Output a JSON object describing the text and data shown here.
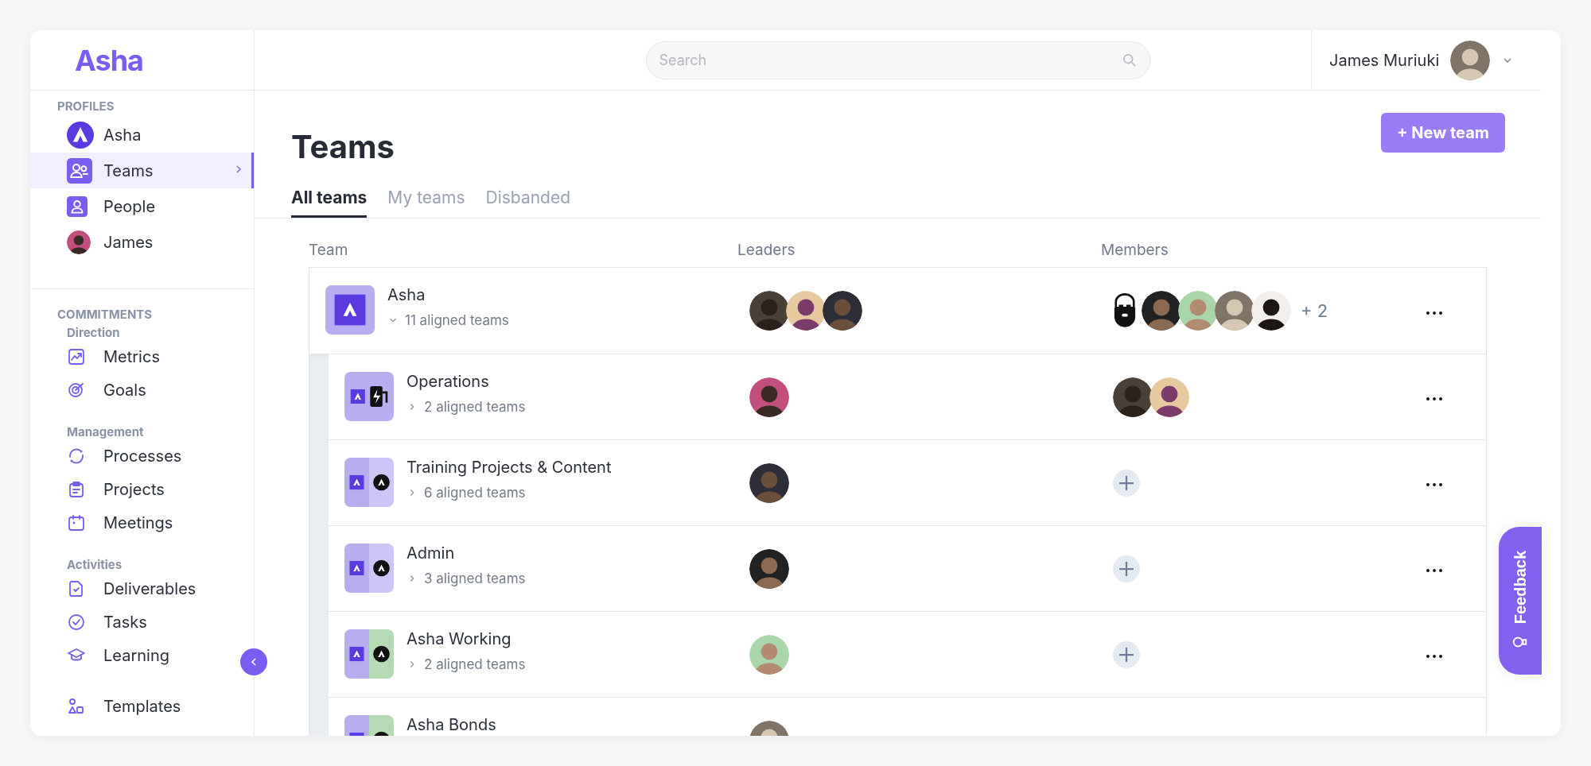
{
  "logo": "Asha",
  "sidebar": {
    "sections": [
      {
        "heading": "PROFILES",
        "groups": [
          {
            "items": [
              {
                "label": "Asha",
                "selected": false
              },
              {
                "label": "Teams",
                "selected": true
              },
              {
                "label": "People",
                "selected": false
              },
              {
                "label": "James",
                "selected": false
              }
            ]
          }
        ]
      },
      {
        "heading": "COMMITMENTS",
        "groups": [
          {
            "title": "Direction",
            "items": [
              {
                "label": "Metrics",
                "selected": false
              },
              {
                "label": "Goals",
                "selected": false
              }
            ]
          },
          {
            "title": "Management",
            "items": [
              {
                "label": "Processes",
                "selected": false
              },
              {
                "label": "Projects",
                "selected": false
              },
              {
                "label": "Meetings",
                "selected": false
              }
            ]
          },
          {
            "title": "Activities",
            "items": [
              {
                "label": "Deliverables",
                "selected": false
              },
              {
                "label": "Tasks",
                "selected": false
              },
              {
                "label": "Learning",
                "selected": false
              }
            ]
          },
          {
            "items": [
              {
                "label": "Templates",
                "selected": false
              }
            ]
          }
        ]
      }
    ]
  },
  "search": {
    "placeholder": "Search"
  },
  "user": {
    "name": "James Muriuki"
  },
  "page_title": "Teams",
  "new_button": "+ New team",
  "tabs": [
    {
      "label": "All teams",
      "selected": true
    },
    {
      "label": "My teams",
      "selected": false
    },
    {
      "label": "Disbanded",
      "selected": false
    }
  ],
  "table": {
    "columns": [
      "Team",
      "Leaders",
      "Members"
    ],
    "rows": [
      {
        "name": "Asha",
        "aligned": "11 aligned teams",
        "expanded": true,
        "icon": {
          "kind": "single"
        },
        "leaders": [
          {
            "kind": "photo"
          },
          {
            "kind": "photo"
          },
          {
            "kind": "photo"
          }
        ],
        "members": [
          {
            "kind": "illustration"
          },
          {
            "kind": "photo"
          },
          {
            "kind": "photo"
          },
          {
            "kind": "photo"
          },
          {
            "kind": "photo"
          }
        ],
        "members_more": "+ 2",
        "children": [
          {
            "name": "Operations",
            "aligned": "2 aligned teams",
            "expanded": false,
            "icon": {
              "kind": "bolt"
            },
            "leaders": [
              {
                "kind": "photo"
              }
            ],
            "members": [
              {
                "kind": "photo"
              },
              {
                "kind": "photo"
              }
            ]
          },
          {
            "name": "Training Projects & Content",
            "aligned": "6 aligned teams",
            "expanded": false,
            "icon": {
              "kind": "pair",
              "color": "#cbc6f6"
            },
            "leaders": [
              {
                "kind": "photo"
              }
            ]
          },
          {
            "name": "Admin",
            "aligned": "3 aligned teams",
            "expanded": false,
            "icon": {
              "kind": "pair",
              "color": "#cbc6f6"
            },
            "leaders": [
              {
                "kind": "photo"
              }
            ]
          },
          {
            "name": "Asha Working",
            "aligned": "2 aligned teams",
            "expanded": false,
            "icon": {
              "kind": "pair",
              "color": "#b4dbb3"
            },
            "leaders": [
              {
                "kind": "photo"
              }
            ]
          },
          {
            "name": "Asha Bonds",
            "icon": {
              "kind": "pair",
              "color": "#b4dbb3"
            },
            "leaders": [
              {
                "kind": "photo"
              }
            ]
          }
        ]
      }
    ]
  },
  "feedback": "Feedback"
}
